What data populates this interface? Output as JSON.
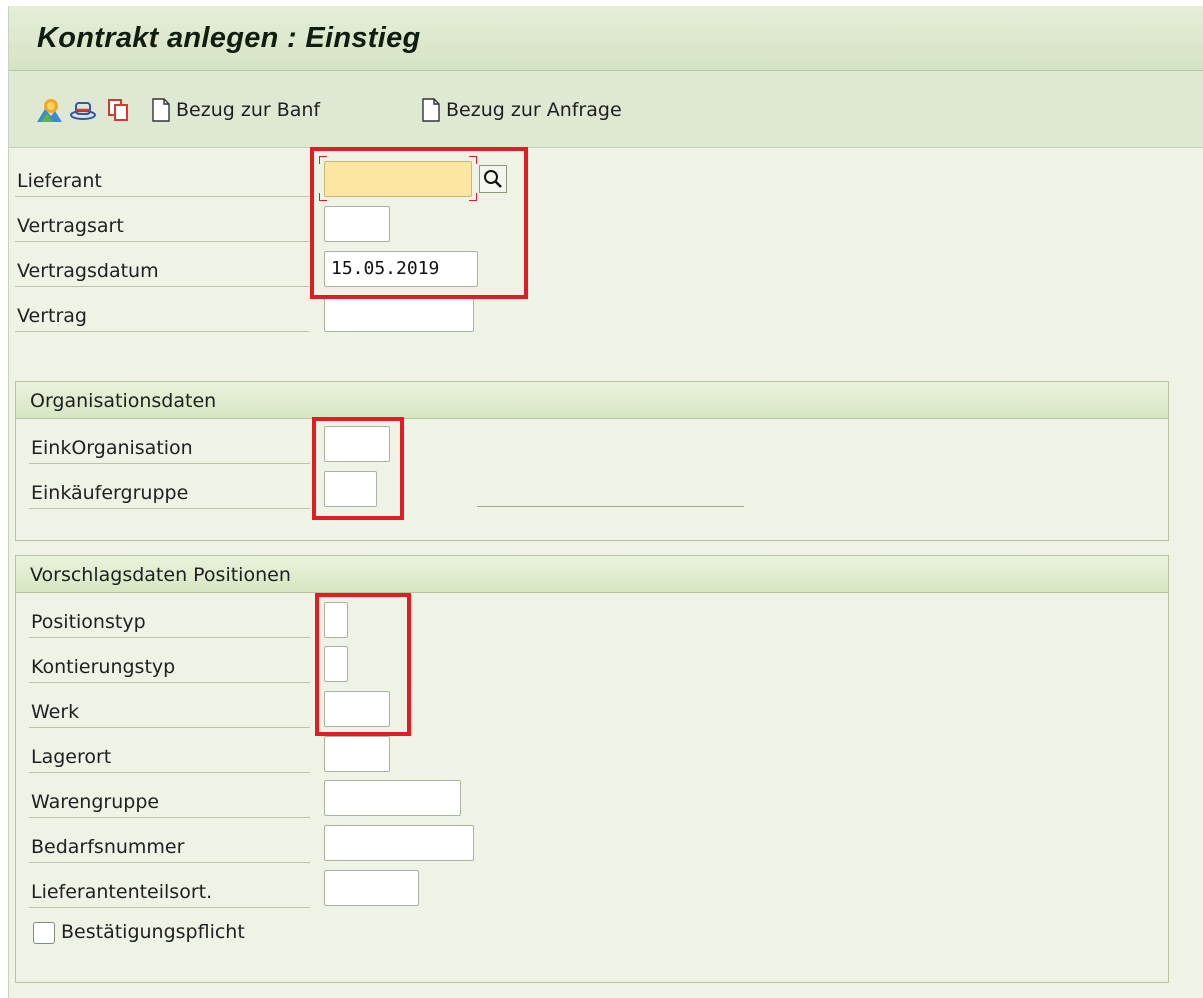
{
  "title": "Kontrakt anlegen : Einstieg",
  "toolbar": {
    "icons": [
      "sun-landscape-icon",
      "hat-icon",
      "copy-icon"
    ],
    "btn_banf": "Bezug zur Banf",
    "btn_anfrage": "Bezug zur Anfrage"
  },
  "header_fields": {
    "lieferant": {
      "label": "Lieferant",
      "value": ""
    },
    "vertragsart": {
      "label": "Vertragsart",
      "value": ""
    },
    "vertragsdatum": {
      "label": "Vertragsdatum",
      "value": "15.05.2019"
    },
    "vertrag": {
      "label": "Vertrag",
      "value": ""
    }
  },
  "org_group": {
    "title": "Organisationsdaten",
    "eink_org": {
      "label": "EinkOrganisation",
      "value": ""
    },
    "einkaeufergruppe": {
      "label": "Einkäufergruppe",
      "value": ""
    }
  },
  "pos_group": {
    "title": "Vorschlagsdaten Positionen",
    "positionstyp": {
      "label": "Positionstyp",
      "value": ""
    },
    "kontierungstyp": {
      "label": "Kontierungstyp",
      "value": ""
    },
    "werk": {
      "label": "Werk",
      "value": ""
    },
    "lagerort": {
      "label": "Lagerort",
      "value": ""
    },
    "warengruppe": {
      "label": "Warengruppe",
      "value": ""
    },
    "bedarfsnummer": {
      "label": "Bedarfsnummer",
      "value": ""
    },
    "lieferantenteilsort": {
      "label": "Lieferantenteilsort.",
      "value": ""
    },
    "bestaetigungspflicht": {
      "label": "Bestätigungspflicht",
      "checked": false
    }
  },
  "colors": {
    "highlight": "#e01d24",
    "required_field": "#fde7a0",
    "background": "#eef3e6"
  }
}
